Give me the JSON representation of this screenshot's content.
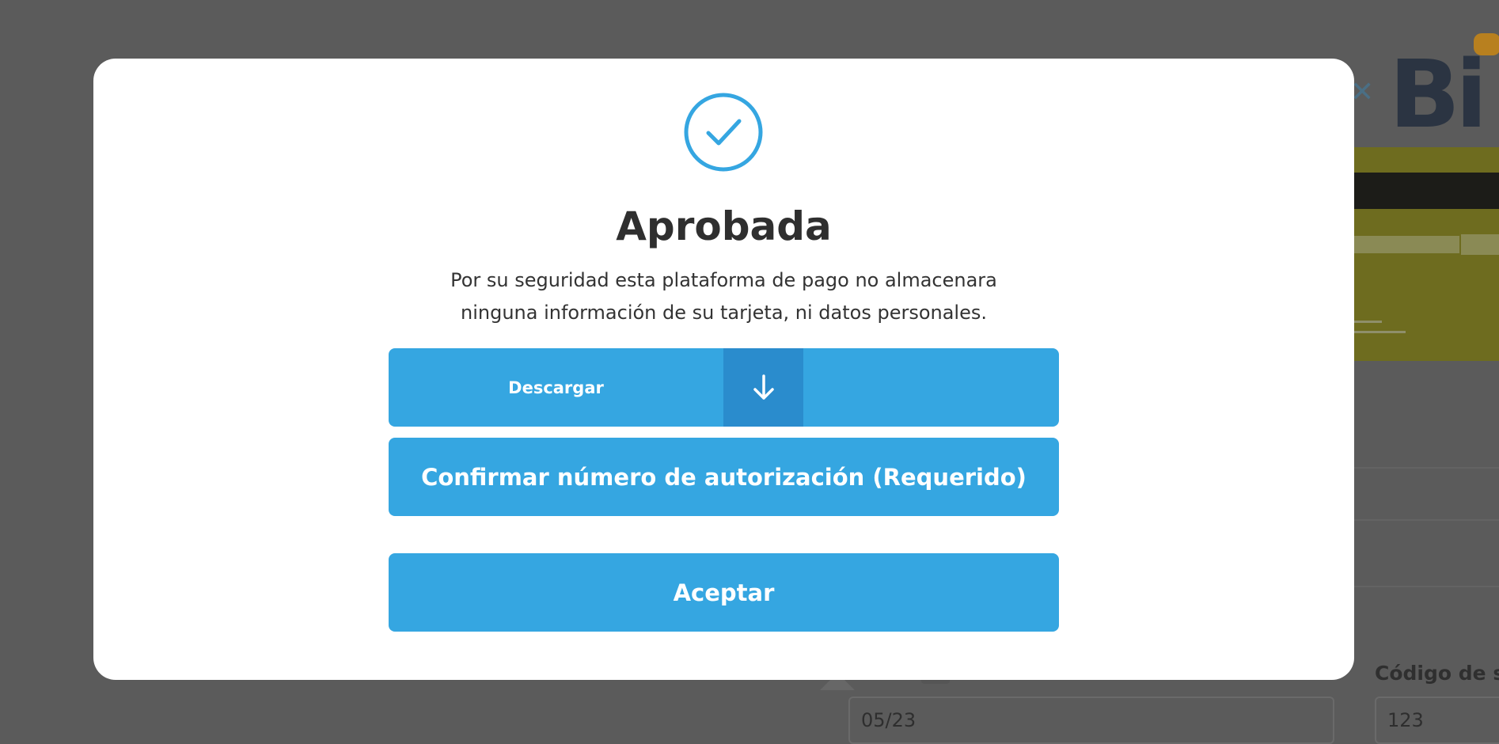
{
  "background": {
    "logo_text": "Bi",
    "security_code_label": "Código de se",
    "expiry_value": "05/23",
    "cvv_value": "123"
  },
  "modal": {
    "status_icon": "check-circle-icon",
    "title": "Aprobada",
    "message_line1": "Por su seguridad esta plataforma de pago no almacenara",
    "message_line2": "ninguna información de su tarjeta, ni datos personales.",
    "download_label": "Descargar",
    "download_icon": "arrow-down-icon",
    "confirm_label": "Confirmar número de autorización (Requerido)",
    "accept_label": "Aceptar"
  },
  "colors": {
    "accent": "#35a6e1",
    "accent_dark": "#2a8ccd",
    "overlay": "#5b5b5b",
    "title": "#2f2f2f"
  }
}
